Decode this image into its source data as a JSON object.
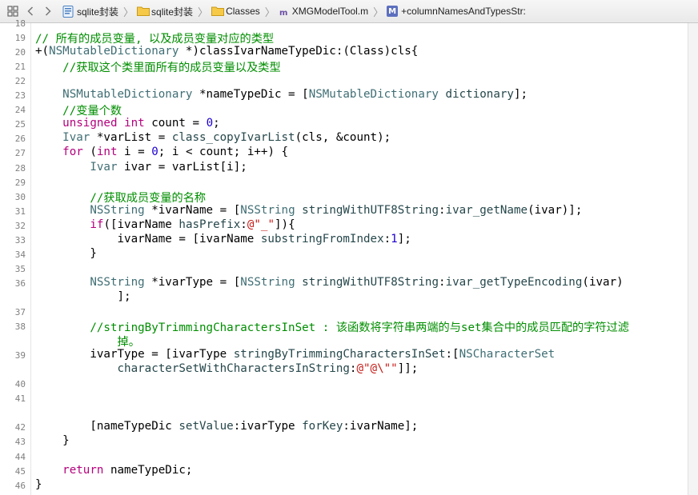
{
  "breadcrumb": {
    "items": [
      {
        "icon": "project-file-icon",
        "label": "sqlite封装"
      },
      {
        "icon": "folder-icon",
        "label": "sqlite封装"
      },
      {
        "icon": "folder-icon",
        "label": "Classes"
      },
      {
        "icon": "objc-implementation-file-icon",
        "label": "XMGModelTool.m"
      },
      {
        "icon": "method-icon",
        "label": "+columnNamesAndTypesStr:"
      }
    ],
    "method_badge": "M",
    "file_badge": "m"
  },
  "colors": {
    "comment": "#008e00",
    "keyword": "#b4007d",
    "type": "#3f6e74",
    "string": "#c41a16",
    "number": "#1c00cf"
  },
  "lines": [
    {
      "num": "18",
      "tokens": []
    },
    {
      "num": "19",
      "tokens": [
        [
          "c",
          "// 所有的成员变量, 以及成员变量对应的类型"
        ]
      ]
    },
    {
      "num": "20",
      "tokens": [
        [
          "p",
          "+("
        ],
        [
          "t",
          "NSMutableDictionary"
        ],
        [
          "p",
          " *)classIvarNameTypeDic:(Class)cls{"
        ]
      ]
    },
    {
      "num": "21",
      "tokens": [
        [
          "p",
          "    "
        ],
        [
          "c",
          "//获取这个类里面所有的成员变量以及类型"
        ]
      ]
    },
    {
      "num": "22",
      "tokens": []
    },
    {
      "num": "23",
      "tokens": [
        [
          "p",
          "    "
        ],
        [
          "t",
          "NSMutableDictionary"
        ],
        [
          "p",
          " *nameTypeDic = ["
        ],
        [
          "t",
          "NSMutableDictionary"
        ],
        [
          "p",
          " "
        ],
        [
          "m",
          "dictionary"
        ],
        [
          "p",
          "];"
        ]
      ]
    },
    {
      "num": "24",
      "tokens": [
        [
          "p",
          "    "
        ],
        [
          "c",
          "//变量个数"
        ]
      ]
    },
    {
      "num": "25",
      "tokens": [
        [
          "p",
          "    "
        ],
        [
          "k",
          "unsigned"
        ],
        [
          "p",
          " "
        ],
        [
          "k",
          "int"
        ],
        [
          "p",
          " count = "
        ],
        [
          "n",
          "0"
        ],
        [
          "p",
          ";"
        ]
      ]
    },
    {
      "num": "26",
      "tokens": [
        [
          "p",
          "    "
        ],
        [
          "t",
          "Ivar"
        ],
        [
          "p",
          " *varList = "
        ],
        [
          "m",
          "class_copyIvarList"
        ],
        [
          "p",
          "(cls, &count);"
        ]
      ]
    },
    {
      "num": "27",
      "tokens": [
        [
          "p",
          "    "
        ],
        [
          "k",
          "for"
        ],
        [
          "p",
          " ("
        ],
        [
          "k",
          "int"
        ],
        [
          "p",
          " i = "
        ],
        [
          "n",
          "0"
        ],
        [
          "p",
          "; i < count; i++) {"
        ]
      ]
    },
    {
      "num": "28",
      "tokens": [
        [
          "p",
          "        "
        ],
        [
          "t",
          "Ivar"
        ],
        [
          "p",
          " ivar = varList[i];"
        ]
      ]
    },
    {
      "num": "29",
      "tokens": []
    },
    {
      "num": "30",
      "tokens": [
        [
          "p",
          "        "
        ],
        [
          "c",
          "//获取成员变量的名称"
        ]
      ]
    },
    {
      "num": "31",
      "tokens": [
        [
          "p",
          "        "
        ],
        [
          "t",
          "NSString"
        ],
        [
          "p",
          " *ivarName = ["
        ],
        [
          "t",
          "NSString"
        ],
        [
          "p",
          " "
        ],
        [
          "m",
          "stringWithUTF8String"
        ],
        [
          "p",
          ":"
        ],
        [
          "m",
          "ivar_getName"
        ],
        [
          "p",
          "(ivar)];"
        ]
      ]
    },
    {
      "num": "32",
      "tokens": [
        [
          "p",
          "        "
        ],
        [
          "k",
          "if"
        ],
        [
          "p",
          "([ivarName "
        ],
        [
          "m",
          "hasPrefix"
        ],
        [
          "p",
          ":"
        ],
        [
          "s",
          "@\"_\""
        ],
        [
          "p",
          "]){"
        ]
      ]
    },
    {
      "num": "33",
      "tokens": [
        [
          "p",
          "            ivarName = [ivarName "
        ],
        [
          "m",
          "substringFromIndex"
        ],
        [
          "p",
          ":"
        ],
        [
          "n",
          "1"
        ],
        [
          "p",
          "];"
        ]
      ]
    },
    {
      "num": "34",
      "tokens": [
        [
          "p",
          "        }"
        ]
      ]
    },
    {
      "num": "35",
      "tokens": []
    },
    {
      "num": "36",
      "tokens": [
        [
          "p",
          "        "
        ],
        [
          "t",
          "NSString"
        ],
        [
          "p",
          " *ivarType = ["
        ],
        [
          "t",
          "NSString"
        ],
        [
          "p",
          " "
        ],
        [
          "m",
          "stringWithUTF8String"
        ],
        [
          "p",
          ":"
        ],
        [
          "m",
          "ivar_getTypeEncoding"
        ],
        [
          "p",
          "(ivar)"
        ]
      ]
    },
    {
      "num": "",
      "tokens": [
        [
          "p",
          "            ];"
        ]
      ]
    },
    {
      "num": "37",
      "tokens": []
    },
    {
      "num": "38",
      "tokens": [
        [
          "p",
          "        "
        ],
        [
          "c",
          "//stringByTrimmingCharactersInSet : 该函数将字符串两端的与set集合中的成员匹配的字符过滤"
        ]
      ]
    },
    {
      "num": "",
      "tokens": [
        [
          "p",
          "            "
        ],
        [
          "c",
          "掉。"
        ]
      ]
    },
    {
      "num": "39",
      "tokens": [
        [
          "p",
          "        ivarType = [ivarType "
        ],
        [
          "m",
          "stringByTrimmingCharactersInSet"
        ],
        [
          "p",
          ":["
        ],
        [
          "t",
          "NSCharacterSet"
        ]
      ]
    },
    {
      "num": "",
      "tokens": [
        [
          "p",
          "            "
        ],
        [
          "m",
          "characterSetWithCharactersInString"
        ],
        [
          "p",
          ":"
        ],
        [
          "s",
          "@\"@\\\"\""
        ],
        [
          "p",
          "]];"
        ]
      ]
    },
    {
      "num": "40",
      "tokens": []
    },
    {
      "num": "41",
      "tokens": []
    },
    {
      "num": "",
      "tokens": []
    },
    {
      "num": "42",
      "tokens": [
        [
          "p",
          "        [nameTypeDic "
        ],
        [
          "m",
          "setValue"
        ],
        [
          "p",
          ":ivarType "
        ],
        [
          "m",
          "forKey"
        ],
        [
          "p",
          ":ivarName];"
        ]
      ]
    },
    {
      "num": "43",
      "tokens": [
        [
          "p",
          "    }"
        ]
      ]
    },
    {
      "num": "44",
      "tokens": []
    },
    {
      "num": "45",
      "tokens": [
        [
          "p",
          "    "
        ],
        [
          "k",
          "return"
        ],
        [
          "p",
          " nameTypeDic;"
        ]
      ]
    },
    {
      "num": "46",
      "tokens": [
        [
          "p",
          "}"
        ]
      ]
    }
  ]
}
